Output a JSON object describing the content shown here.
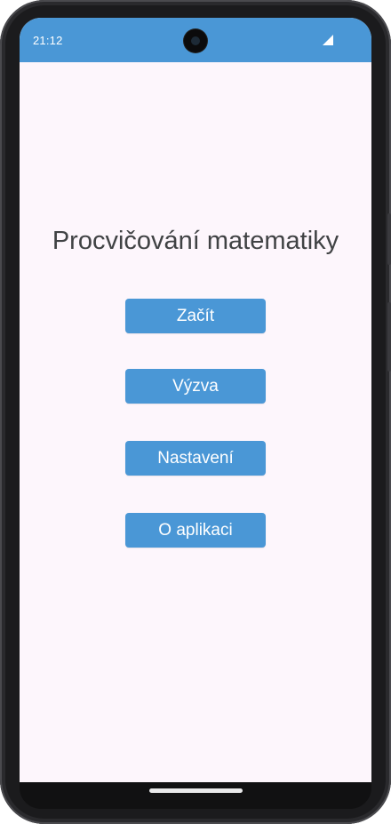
{
  "status_bar": {
    "time": "21:12",
    "background_color": "#4a97d6",
    "icons": [
      "camera-cutout",
      "signal-icon"
    ]
  },
  "main": {
    "title": "Procvičování matematiky",
    "buttons": [
      {
        "label": "Začít"
      },
      {
        "label": "Výzva"
      },
      {
        "label": "Nastavení"
      },
      {
        "label": "O aplikaci"
      }
    ]
  },
  "colors": {
    "accent": "#4a97d6",
    "screen_background": "#fdf6fc",
    "title_text": "#404244"
  }
}
